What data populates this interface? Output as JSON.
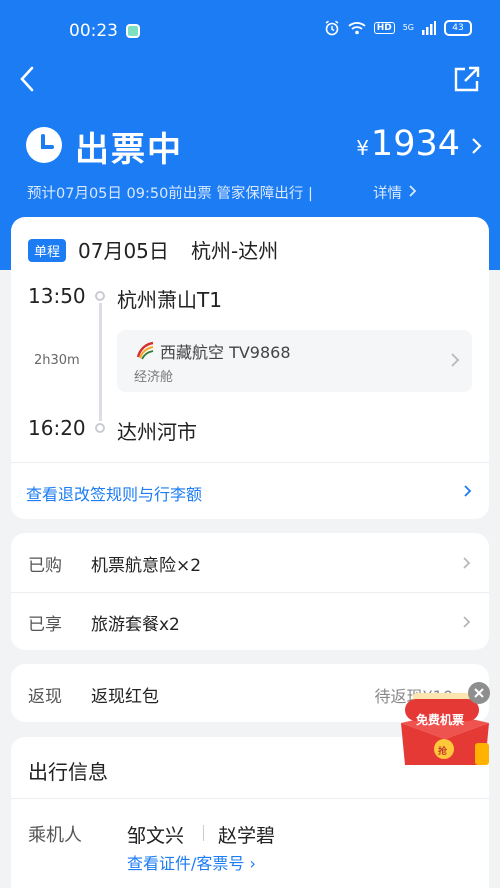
{
  "status_bar": {
    "time": "00:23",
    "hd": "HD",
    "network": "5G",
    "battery": "43"
  },
  "header": {
    "status_title": "出票中",
    "price_currency": "¥",
    "price_value": "1934",
    "notice": "预计07月05日 09:50前出票 管家保障出行 |",
    "detail_label": "详情",
    "background_color": "#1c7cf4"
  },
  "flight": {
    "tag": "单程",
    "date": "07月05日",
    "route": "杭州-达州",
    "departure_time": "13:50",
    "departure_place": "杭州萧山T1",
    "duration": "2h30m",
    "airline": "西藏航空 TV9868",
    "cabin": "经济舱",
    "arrival_time": "16:20",
    "arrival_place": "达州河市",
    "rules_link": "查看退改签规则与行李额"
  },
  "purchases": [
    {
      "label": "已购",
      "value": "机票航意险×2"
    },
    {
      "label": "已享",
      "value": "旅游套餐x2"
    }
  ],
  "cashback": {
    "label": "返现",
    "value": "返现红包",
    "status": "待返现¥10"
  },
  "travel_info": {
    "title": "出行信息",
    "passenger_label": "乘机人",
    "passengers": [
      "邹文兴",
      "赵学碧"
    ],
    "id_link": "查看证件/客票号 ›"
  },
  "red_packet": {
    "text": "免费机票",
    "coin": "抢"
  },
  "icons": {
    "back": "back-arrow-icon",
    "share": "share-icon",
    "status": "clock-icon",
    "airline_logo": "tibet-airlines-logo-icon"
  }
}
